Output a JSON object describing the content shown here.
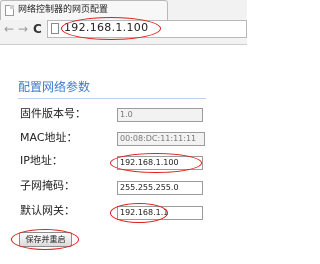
{
  "browser": {
    "tab_title": "网络控制器的网页配置",
    "address": "192.168.1.100"
  },
  "page": {
    "title": "配置网络参数",
    "fields": [
      {
        "label": "固件版本号：",
        "value": "1.0",
        "readonly": true
      },
      {
        "label": "MAC地址：",
        "value": "00:08:DC:11:11:11",
        "readonly": true
      },
      {
        "label": "IP地址：",
        "value": "192.168.1.100",
        "readonly": false,
        "highlighted": true
      },
      {
        "label": "子网掩码：",
        "value": "255.255.255.0",
        "readonly": false
      },
      {
        "label": "默认网关：",
        "value": "192.168.1.1",
        "readonly": false,
        "highlighted": true
      }
    ],
    "save_button": "保存并重启"
  },
  "colors": {
    "title": "#3a7bc8",
    "annotation": "#e21b1b"
  }
}
